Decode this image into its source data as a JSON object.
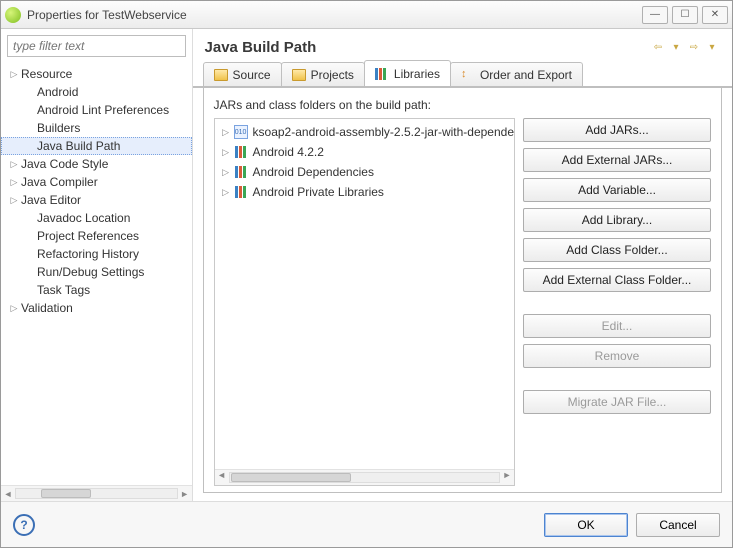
{
  "window": {
    "title": "Properties for TestWebservice"
  },
  "filter": {
    "placeholder": "type filter text"
  },
  "tree": [
    {
      "label": "Resource",
      "expandable": true,
      "indent": 0
    },
    {
      "label": "Android",
      "expandable": false,
      "indent": 1
    },
    {
      "label": "Android Lint Preferences",
      "expandable": false,
      "indent": 1
    },
    {
      "label": "Builders",
      "expandable": false,
      "indent": 1
    },
    {
      "label": "Java Build Path",
      "expandable": false,
      "indent": 1,
      "selected": true
    },
    {
      "label": "Java Code Style",
      "expandable": true,
      "indent": 0
    },
    {
      "label": "Java Compiler",
      "expandable": true,
      "indent": 0
    },
    {
      "label": "Java Editor",
      "expandable": true,
      "indent": 0
    },
    {
      "label": "Javadoc Location",
      "expandable": false,
      "indent": 1
    },
    {
      "label": "Project References",
      "expandable": false,
      "indent": 1
    },
    {
      "label": "Refactoring History",
      "expandable": false,
      "indent": 1
    },
    {
      "label": "Run/Debug Settings",
      "expandable": false,
      "indent": 1
    },
    {
      "label": "Task Tags",
      "expandable": false,
      "indent": 1
    },
    {
      "label": "Validation",
      "expandable": true,
      "indent": 0
    }
  ],
  "page": {
    "title": "Java Build Path"
  },
  "tabs": {
    "source": {
      "label": "Source"
    },
    "projects": {
      "label": "Projects"
    },
    "libraries": {
      "label": "Libraries",
      "active": true
    },
    "order": {
      "label": "Order and Export"
    }
  },
  "libraries": {
    "desc": "JARs and class folders on the build path:",
    "items": [
      {
        "label": "ksoap2-android-assembly-2.5.2-jar-with-depende",
        "icon": "jar"
      },
      {
        "label": "Android 4.2.2",
        "icon": "books"
      },
      {
        "label": "Android Dependencies",
        "icon": "books"
      },
      {
        "label": "Android Private Libraries",
        "icon": "books"
      }
    ]
  },
  "buttons": {
    "addJars": "Add JARs...",
    "addExtJars": "Add External JARs...",
    "addVar": "Add Variable...",
    "addLib": "Add Library...",
    "addClassFolder": "Add Class Folder...",
    "addExtClassFolder": "Add External Class Folder...",
    "edit": "Edit...",
    "remove": "Remove",
    "migrate": "Migrate JAR File..."
  },
  "footer": {
    "ok": "OK",
    "cancel": "Cancel"
  }
}
